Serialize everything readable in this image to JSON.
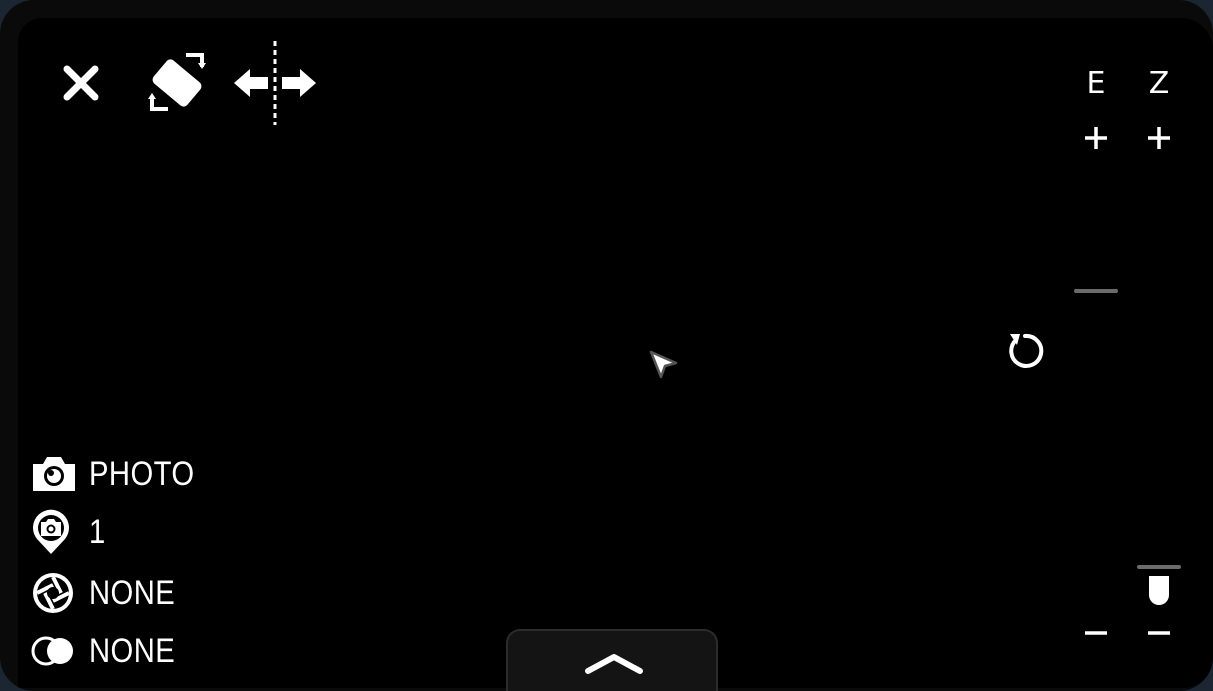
{
  "toolbar": {
    "close_icon": "close-icon",
    "rotate_icon": "rotate-orientation-icon",
    "mirror_icon": "mirror-flip-icon"
  },
  "zoom_panel": {
    "exposure_label": "E",
    "zoom_label": "Z",
    "plus_icon": "plus-icon",
    "minus_icon": "minus-icon",
    "reset_icon": "reset-rotate-icon"
  },
  "status": {
    "mode": {
      "icon": "camera-icon",
      "value": "PHOTO"
    },
    "count": {
      "icon": "location-camera-icon",
      "value": "1"
    },
    "filter": {
      "icon": "aperture-icon",
      "value": "NONE"
    },
    "blend": {
      "icon": "overlap-circles-icon",
      "value": "NONE"
    }
  },
  "drawer": {
    "icon": "chevron-up-icon"
  },
  "colors": {
    "background": "#000000",
    "foreground": "#ffffff",
    "slider_mark": "#6b6b6b",
    "drawer_bg": "#141414"
  }
}
